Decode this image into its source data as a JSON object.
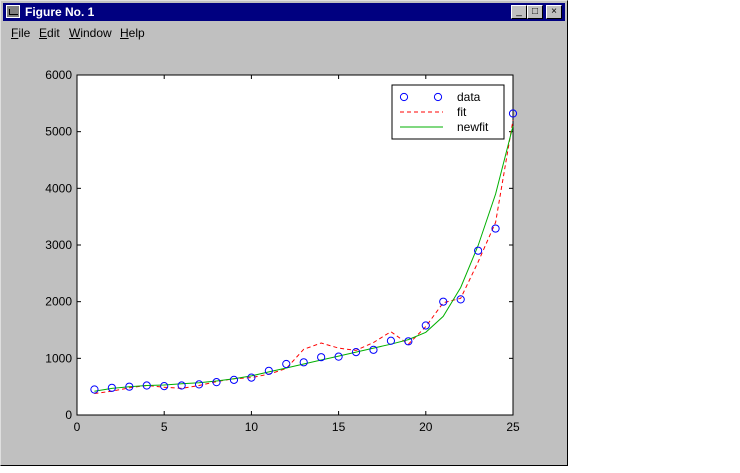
{
  "window": {
    "title": "Figure No. 1",
    "controls": {
      "minimize": "_",
      "maximize": "□",
      "close": "×"
    }
  },
  "menu": [
    {
      "label": "File",
      "accel": "F",
      "rest": "ile"
    },
    {
      "label": "Edit",
      "accel": "E",
      "rest": "dit"
    },
    {
      "label": "Window",
      "accel": "W",
      "rest": "indow"
    },
    {
      "label": "Help",
      "accel": "H",
      "rest": "elp"
    }
  ],
  "chart_data": {
    "type": "line",
    "title": "",
    "xlabel": "",
    "ylabel": "",
    "xlim": [
      0,
      25
    ],
    "ylim": [
      0,
      6000
    ],
    "xticks": [
      0,
      5,
      10,
      15,
      20,
      25
    ],
    "yticks": [
      0,
      1000,
      2000,
      3000,
      4000,
      5000,
      6000
    ],
    "grid": false,
    "legend_position": "top-right",
    "series": [
      {
        "name": "data",
        "style": "markers",
        "color": "#0000ff",
        "x": [
          1,
          2,
          3,
          4,
          5,
          6,
          7,
          8,
          9,
          10,
          11,
          12,
          13,
          14,
          15,
          16,
          17,
          18,
          19,
          20,
          21,
          22,
          23,
          24,
          25
        ],
        "y": [
          450,
          480,
          500,
          520,
          510,
          520,
          540,
          580,
          620,
          660,
          780,
          900,
          930,
          1020,
          1030,
          1110,
          1150,
          1310,
          1300,
          1580,
          2000,
          2040,
          2900,
          3290,
          5320
        ]
      },
      {
        "name": "fit",
        "style": "dashed",
        "color": "#ff0000",
        "x": [
          1,
          2,
          3,
          4,
          5,
          6,
          7,
          8,
          9,
          10,
          11,
          12,
          13,
          14,
          15,
          16,
          17,
          18,
          19,
          20,
          21,
          22,
          23,
          24,
          25
        ],
        "y": [
          380,
          420,
          480,
          520,
          490,
          470,
          520,
          590,
          640,
          660,
          720,
          820,
          1160,
          1270,
          1180,
          1140,
          1280,
          1470,
          1250,
          1560,
          1980,
          2060,
          2700,
          3400,
          5200
        ]
      },
      {
        "name": "newfit",
        "style": "solid",
        "color": "#00b000",
        "x": [
          1,
          2,
          3,
          4,
          5,
          6,
          7,
          8,
          9,
          10,
          11,
          12,
          13,
          14,
          15,
          16,
          17,
          18,
          19,
          20,
          21,
          22,
          23,
          24,
          25
        ],
        "y": [
          420,
          470,
          500,
          520,
          530,
          550,
          570,
          600,
          640,
          690,
          760,
          830,
          900,
          970,
          1040,
          1110,
          1180,
          1250,
          1330,
          1460,
          1740,
          2250,
          2990,
          3900,
          5100
        ]
      }
    ]
  }
}
